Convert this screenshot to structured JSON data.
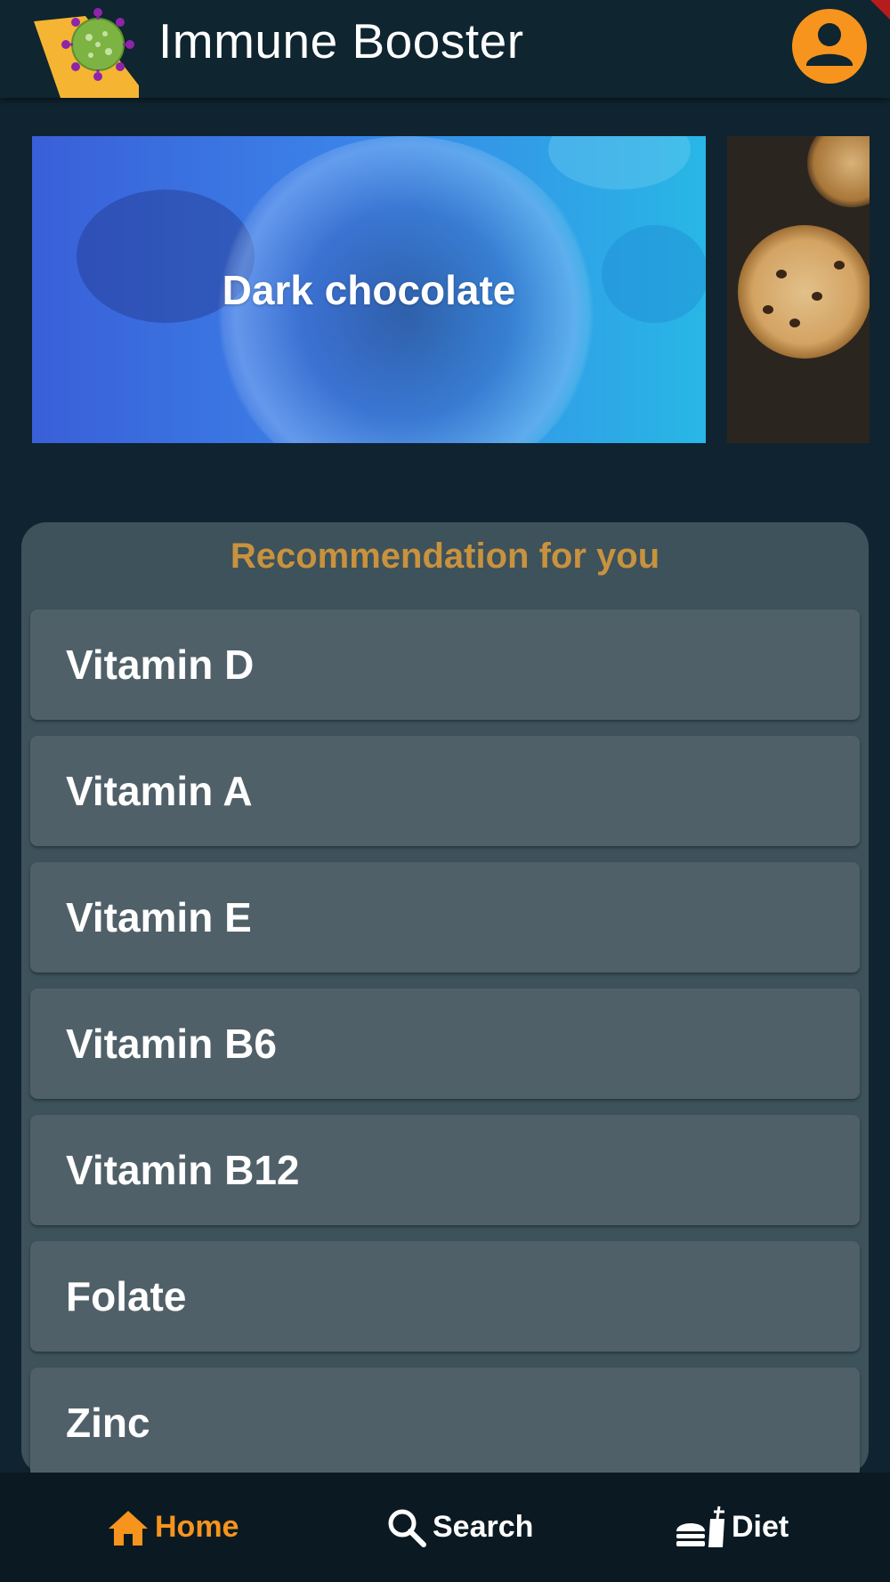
{
  "app": {
    "title": "Immune Booster",
    "accent_color": "#f7941d",
    "background_color": "#0f2430"
  },
  "header": {
    "logo_icon": "virus-logo-icon",
    "profile_icon": "account-circle-icon"
  },
  "carousel": {
    "items": [
      {
        "label": "Dark chocolate"
      },
      {
        "label": ""
      }
    ]
  },
  "recommendations": {
    "title": "Recommendation for you",
    "title_color": "#c8923e",
    "items": [
      {
        "label": "Vitamin D"
      },
      {
        "label": "Vitamin A"
      },
      {
        "label": "Vitamin E"
      },
      {
        "label": "Vitamin B6"
      },
      {
        "label": "Vitamin B12"
      },
      {
        "label": "Folate"
      },
      {
        "label": "Zinc"
      }
    ]
  },
  "bottom_nav": {
    "items": [
      {
        "label": "Home",
        "icon": "home-icon",
        "active": true
      },
      {
        "label": "Search",
        "icon": "search-icon",
        "active": false
      },
      {
        "label": "Diet",
        "icon": "diet-icon",
        "active": false
      }
    ]
  }
}
